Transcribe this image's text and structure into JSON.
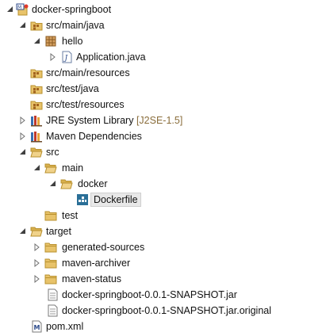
{
  "project": {
    "name": "docker-springboot"
  },
  "tree": {
    "src_main_java": "src/main/java",
    "hello": "hello",
    "application_java": "Application.java",
    "src_main_resources": "src/main/resources",
    "src_test_java": "src/test/java",
    "src_test_resources": "src/test/resources",
    "jre_library": "JRE System Library",
    "jre_decoration": "[J2SE-1.5]",
    "maven_dependencies": "Maven Dependencies",
    "src": "src",
    "main": "main",
    "docker": "docker",
    "dockerfile": "Dockerfile",
    "test": "test",
    "target": "target",
    "generated_sources": "generated-sources",
    "maven_archiver": "maven-archiver",
    "maven_status": "maven-status",
    "jar": "docker-springboot-0.0.1-SNAPSHOT.jar",
    "jar_original": "docker-springboot-0.0.1-SNAPSHOT.jar.original",
    "pom": "pom.xml"
  },
  "colors": {
    "folder": "#e8c36a",
    "folder_stroke": "#b8902e",
    "package": "#c9894a",
    "selection_bg": "#e8e8e8",
    "decoration_text": "#8a6d3b"
  }
}
